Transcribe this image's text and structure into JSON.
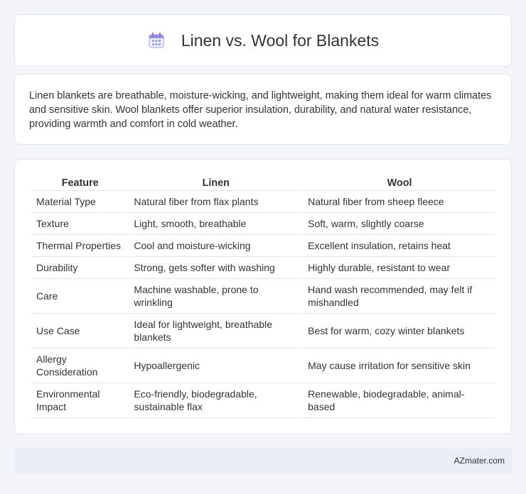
{
  "header": {
    "title": "Linen vs. Wool for Blankets",
    "icon": "calendar-icon"
  },
  "summary": {
    "text": "Linen blankets are breathable, moisture-wicking, and lightweight, making them ideal for warm climates and sensitive skin. Wool blankets offer superior insulation, durability, and natural water resistance, providing warmth and comfort in cold weather."
  },
  "table": {
    "headers": [
      "Feature",
      "Linen",
      "Wool"
    ],
    "rows": [
      [
        "Material Type",
        "Natural fiber from flax plants",
        "Natural fiber from sheep fleece"
      ],
      [
        "Texture",
        "Light, smooth, breathable",
        "Soft, warm, slightly coarse"
      ],
      [
        "Thermal Properties",
        "Cool and moisture-wicking",
        "Excellent insulation, retains heat"
      ],
      [
        "Durability",
        "Strong, gets softer with washing",
        "Highly durable, resistant to wear"
      ],
      [
        "Care",
        "Machine washable, prone to wrinkling",
        "Hand wash recommended, may felt if mishandled"
      ],
      [
        "Use Case",
        "Ideal for lightweight, breathable blankets",
        "Best for warm, cozy winter blankets"
      ],
      [
        "Allergy Consideration",
        "Hypoallergenic",
        "May cause irritation for sensitive skin"
      ],
      [
        "Environmental Impact",
        "Eco-friendly, biodegradable, sustainable flax",
        "Renewable, biodegradable, animal-based"
      ]
    ]
  },
  "footer": {
    "text": "AZmater.com"
  },
  "colors": {
    "background": "#f4f5f8",
    "card": "#ffffff",
    "footer_bg": "#e9edf5",
    "icon_accent": "#7b6fd0"
  }
}
